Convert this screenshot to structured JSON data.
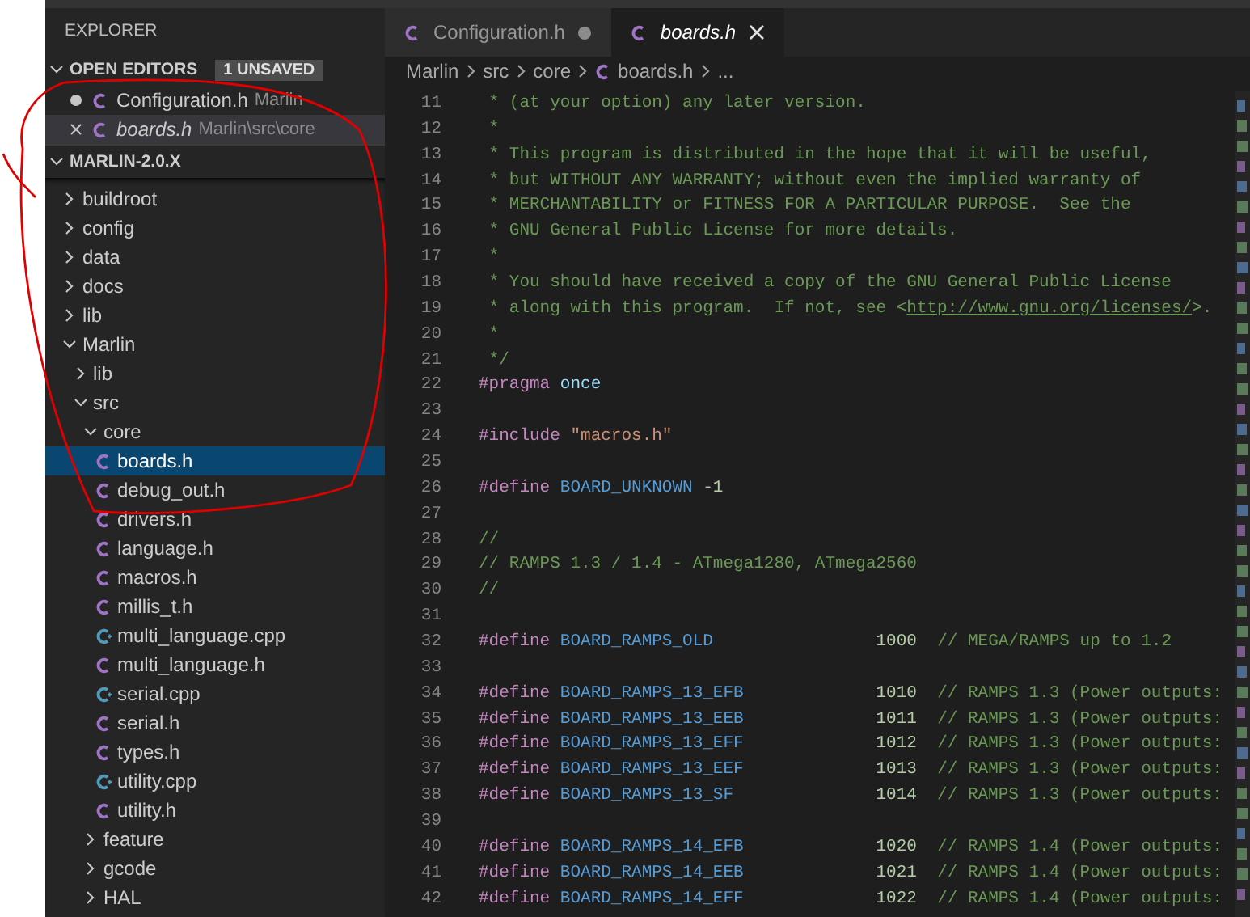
{
  "sidebar": {
    "title": "EXPLORER",
    "open_editors": {
      "label": "OPEN EDITORS",
      "expanded": true,
      "badge": "1 UNSAVED",
      "items": [
        {
          "name": "Configuration.h",
          "description": "Marlin",
          "kind": "c-header",
          "modified": true,
          "preview": false,
          "selected": false
        },
        {
          "name": "boards.h",
          "description": "Marlin\\src\\core",
          "kind": "c-header",
          "modified": false,
          "preview": true,
          "selected": true
        }
      ]
    },
    "workspace": {
      "label": "MARLIN-2.0.X",
      "expanded": true,
      "tree": [
        {
          "name": "buildroot",
          "kind": "folder",
          "expanded": false,
          "selected": false
        },
        {
          "name": "config",
          "kind": "folder",
          "expanded": false,
          "selected": false
        },
        {
          "name": "data",
          "kind": "folder",
          "expanded": false,
          "selected": false
        },
        {
          "name": "docs",
          "kind": "folder",
          "expanded": false,
          "selected": false
        },
        {
          "name": "lib",
          "kind": "folder",
          "expanded": false,
          "selected": false
        },
        {
          "name": "Marlin",
          "kind": "folder",
          "expanded": true,
          "selected": false,
          "children": [
            {
              "name": "lib",
              "kind": "folder",
              "expanded": false,
              "selected": false
            },
            {
              "name": "src",
              "kind": "folder",
              "expanded": true,
              "selected": false,
              "children": [
                {
                  "name": "core",
                  "kind": "folder",
                  "expanded": true,
                  "selected": false,
                  "children": [
                    {
                      "name": "boards.h",
                      "kind": "c-header",
                      "selected": true
                    },
                    {
                      "name": "debug_out.h",
                      "kind": "c-header",
                      "selected": false
                    },
                    {
                      "name": "drivers.h",
                      "kind": "c-header",
                      "selected": false
                    },
                    {
                      "name": "language.h",
                      "kind": "c-header",
                      "selected": false
                    },
                    {
                      "name": "macros.h",
                      "kind": "c-header",
                      "selected": false
                    },
                    {
                      "name": "millis_t.h",
                      "kind": "c-header",
                      "selected": false
                    },
                    {
                      "name": "multi_language.cpp",
                      "kind": "cpp-source",
                      "selected": false
                    },
                    {
                      "name": "multi_language.h",
                      "kind": "c-header",
                      "selected": false
                    },
                    {
                      "name": "serial.cpp",
                      "kind": "cpp-source",
                      "selected": false
                    },
                    {
                      "name": "serial.h",
                      "kind": "c-header",
                      "selected": false
                    },
                    {
                      "name": "types.h",
                      "kind": "c-header",
                      "selected": false
                    },
                    {
                      "name": "utility.cpp",
                      "kind": "cpp-source",
                      "selected": false
                    },
                    {
                      "name": "utility.h",
                      "kind": "c-header",
                      "selected": false
                    }
                  ]
                },
                {
                  "name": "feature",
                  "kind": "folder",
                  "expanded": false,
                  "selected": false
                },
                {
                  "name": "gcode",
                  "kind": "folder",
                  "expanded": false,
                  "selected": false
                },
                {
                  "name": "HAL",
                  "kind": "folder",
                  "expanded": false,
                  "selected": false
                }
              ]
            }
          ]
        }
      ]
    }
  },
  "editor": {
    "tabs": [
      {
        "label": "Configuration.h",
        "kind": "c-header",
        "selected": false,
        "modified": true,
        "preview": false
      },
      {
        "label": "boards.h",
        "kind": "c-header",
        "selected": true,
        "modified": false,
        "preview": true
      }
    ],
    "breadcrumb": [
      {
        "label": "Marlin",
        "kind": "folder"
      },
      {
        "label": "src",
        "kind": "folder"
      },
      {
        "label": "core",
        "kind": "folder"
      },
      {
        "label": "boards.h",
        "kind": "c-header"
      },
      {
        "label": "...",
        "kind": "more"
      }
    ],
    "lines": [
      {
        "number": "11",
        "tokens": [
          {
            "kind": "comment",
            "text": " * (at your option) any later version."
          }
        ]
      },
      {
        "number": "12",
        "tokens": [
          {
            "kind": "comment",
            "text": " *"
          }
        ]
      },
      {
        "number": "13",
        "tokens": [
          {
            "kind": "comment",
            "text": " * This program is distributed in the hope that it will be useful,"
          }
        ]
      },
      {
        "number": "14",
        "tokens": [
          {
            "kind": "comment",
            "text": " * but WITHOUT ANY WARRANTY; without even the implied warranty of"
          }
        ]
      },
      {
        "number": "15",
        "tokens": [
          {
            "kind": "comment",
            "text": " * MERCHANTABILITY or FITNESS FOR A PARTICULAR PURPOSE.  See the"
          }
        ]
      },
      {
        "number": "16",
        "tokens": [
          {
            "kind": "comment",
            "text": " * GNU General Public License for more details."
          }
        ]
      },
      {
        "number": "17",
        "tokens": [
          {
            "kind": "comment",
            "text": " *"
          }
        ]
      },
      {
        "number": "18",
        "tokens": [
          {
            "kind": "comment",
            "text": " * You should have received a copy of the GNU General Public License"
          }
        ]
      },
      {
        "number": "19",
        "tokens": [
          {
            "kind": "comment",
            "text": " * along with this program.  If not, see <"
          },
          {
            "kind": "link",
            "text": "http://www.gnu.org/licenses/"
          },
          {
            "kind": "comment",
            "text": ">."
          }
        ]
      },
      {
        "number": "20",
        "tokens": [
          {
            "kind": "comment",
            "text": " *"
          }
        ]
      },
      {
        "number": "21",
        "tokens": [
          {
            "kind": "comment",
            "text": " */"
          }
        ]
      },
      {
        "number": "22",
        "tokens": [
          {
            "kind": "directive",
            "text": "#pragma"
          },
          {
            "kind": "identifier",
            "text": " once"
          }
        ]
      },
      {
        "number": "23"
      },
      {
        "number": "24",
        "tokens": [
          {
            "kind": "directive",
            "text": "#include"
          },
          {
            "kind": "string",
            "text": " \"macros.h\""
          }
        ]
      },
      {
        "number": "25"
      },
      {
        "number": "26",
        "tokens": [
          {
            "kind": "directive",
            "text": "#define"
          },
          {
            "kind": "macro",
            "text": " BOARD_UNKNOWN"
          },
          {
            "kind": "number",
            "text": " -1"
          }
        ]
      },
      {
        "number": "27"
      },
      {
        "number": "28",
        "tokens": [
          {
            "kind": "comment",
            "text": "//"
          }
        ]
      },
      {
        "number": "29",
        "tokens": [
          {
            "kind": "comment",
            "text": "// RAMPS 1.3 / 1.4 - ATmega1280, ATmega2560"
          }
        ]
      },
      {
        "number": "30",
        "tokens": [
          {
            "kind": "comment",
            "text": "//"
          }
        ]
      },
      {
        "number": "31"
      },
      {
        "number": "32",
        "tokens": [
          {
            "kind": "directive",
            "text": "#define"
          },
          {
            "kind": "macro",
            "text": " BOARD_RAMPS_OLD"
          },
          {
            "kind": "number",
            "text": "                1000"
          },
          {
            "kind": "comment",
            "text": "  // MEGA/RAMPS up to 1.2"
          }
        ]
      },
      {
        "number": "33"
      },
      {
        "number": "34",
        "tokens": [
          {
            "kind": "directive",
            "text": "#define"
          },
          {
            "kind": "macro",
            "text": " BOARD_RAMPS_13_EFB"
          },
          {
            "kind": "number",
            "text": "             1010"
          },
          {
            "kind": "comment",
            "text": "  // RAMPS 1.3 (Power outputs:"
          }
        ]
      },
      {
        "number": "35",
        "tokens": [
          {
            "kind": "directive",
            "text": "#define"
          },
          {
            "kind": "macro",
            "text": " BOARD_RAMPS_13_EEB"
          },
          {
            "kind": "number",
            "text": "             1011"
          },
          {
            "kind": "comment",
            "text": "  // RAMPS 1.3 (Power outputs:"
          }
        ]
      },
      {
        "number": "36",
        "tokens": [
          {
            "kind": "directive",
            "text": "#define"
          },
          {
            "kind": "macro",
            "text": " BOARD_RAMPS_13_EFF"
          },
          {
            "kind": "number",
            "text": "             1012"
          },
          {
            "kind": "comment",
            "text": "  // RAMPS 1.3 (Power outputs:"
          }
        ]
      },
      {
        "number": "37",
        "tokens": [
          {
            "kind": "directive",
            "text": "#define"
          },
          {
            "kind": "macro",
            "text": " BOARD_RAMPS_13_EEF"
          },
          {
            "kind": "number",
            "text": "             1013"
          },
          {
            "kind": "comment",
            "text": "  // RAMPS 1.3 (Power outputs:"
          }
        ]
      },
      {
        "number": "38",
        "tokens": [
          {
            "kind": "directive",
            "text": "#define"
          },
          {
            "kind": "macro",
            "text": " BOARD_RAMPS_13_SF"
          },
          {
            "kind": "number",
            "text": "              1014"
          },
          {
            "kind": "comment",
            "text": "  // RAMPS 1.3 (Power outputs:"
          }
        ]
      },
      {
        "number": "39"
      },
      {
        "number": "40",
        "tokens": [
          {
            "kind": "directive",
            "text": "#define"
          },
          {
            "kind": "macro",
            "text": " BOARD_RAMPS_14_EFB"
          },
          {
            "kind": "number",
            "text": "             1020"
          },
          {
            "kind": "comment",
            "text": "  // RAMPS 1.4 (Power outputs:"
          }
        ]
      },
      {
        "number": "41",
        "tokens": [
          {
            "kind": "directive",
            "text": "#define"
          },
          {
            "kind": "macro",
            "text": " BOARD_RAMPS_14_EEB"
          },
          {
            "kind": "number",
            "text": "             1021"
          },
          {
            "kind": "comment",
            "text": "  // RAMPS 1.4 (Power outputs:"
          }
        ]
      },
      {
        "number": "42",
        "tokens": [
          {
            "kind": "directive",
            "text": "#define"
          },
          {
            "kind": "macro",
            "text": " BOARD_RAMPS_14_EFF"
          },
          {
            "kind": "number",
            "text": "             1022"
          },
          {
            "kind": "comment",
            "text": "  // RAMPS 1.4 (Power outputs:"
          }
        ]
      }
    ]
  }
}
